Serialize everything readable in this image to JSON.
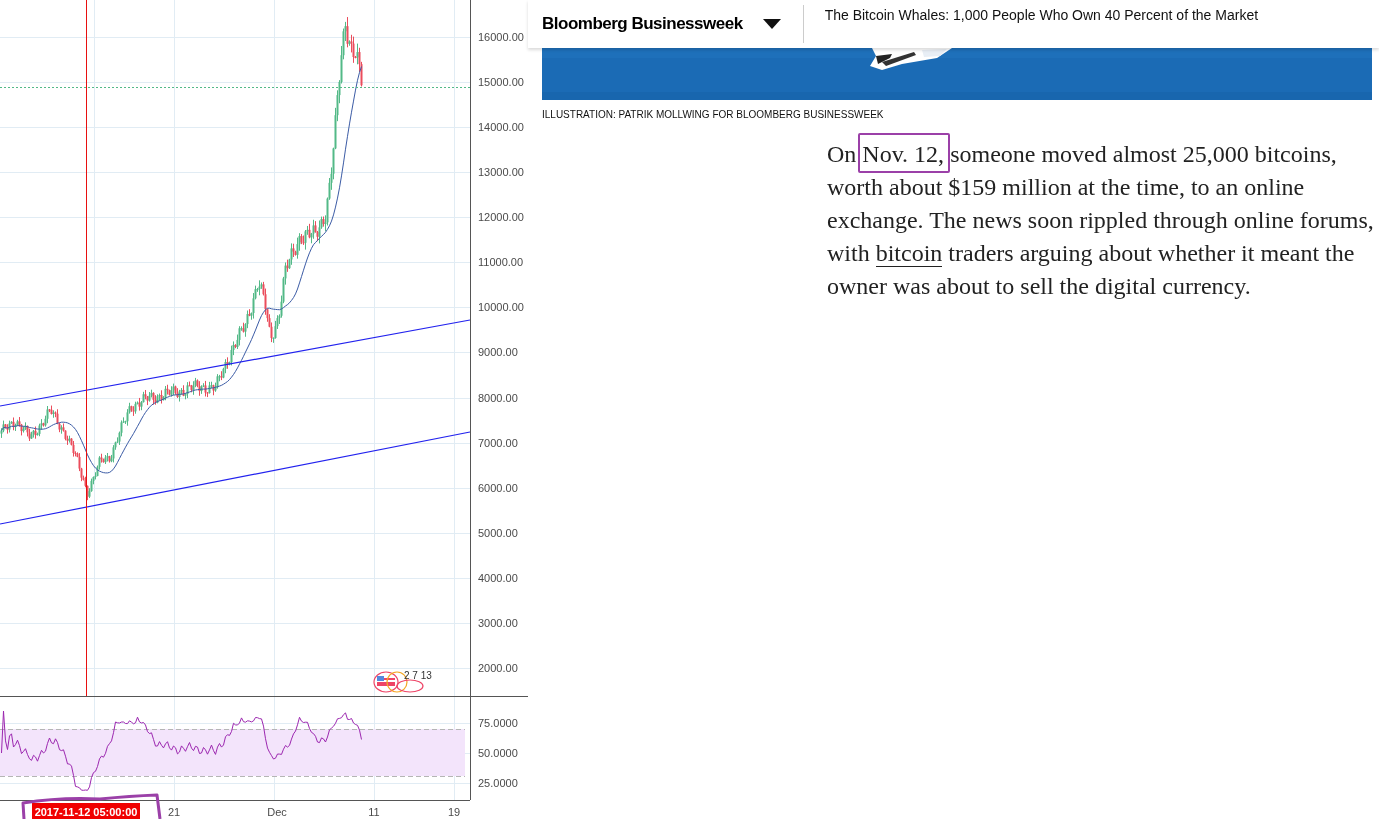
{
  "chart": {
    "price_scale": [
      "16000.00",
      "15000.00",
      "14000.00",
      "13000.00",
      "12000.00",
      "11000.00",
      "10000.00",
      "9000.00",
      "8000.00",
      "7000.00",
      "6000.00",
      "5000.00",
      "4000.00",
      "3000.00",
      "2000.00"
    ],
    "indicator_scale": [
      "75.0000",
      "50.0000",
      "25.0000"
    ],
    "time_scale": [
      "21",
      "Dec",
      "11",
      "19"
    ],
    "crosshair_time": "2017-11-12 05:00:00",
    "event_badge": "2 7 13"
  },
  "article": {
    "brand": "Bloomberg Businessweek",
    "headline": "The Bitcoin Whales: 1,000 People Who Own 40 Percent of the Market",
    "caption": "ILLUSTRATION: PATRIK MOLLWING FOR BLOOMBERG BUSINESSWEEK",
    "paragraph": {
      "before": "On ",
      "marked": "Nov. 12,",
      "middle": " someone moved almost 25,000 bitcoins, worth about $159 million at the time, to an online exchange. The news soon rippled through online forums, with ",
      "link": "bitcoin",
      "after": " traders arguing about whether it meant the owner was about to sell the digital currency."
    }
  }
}
